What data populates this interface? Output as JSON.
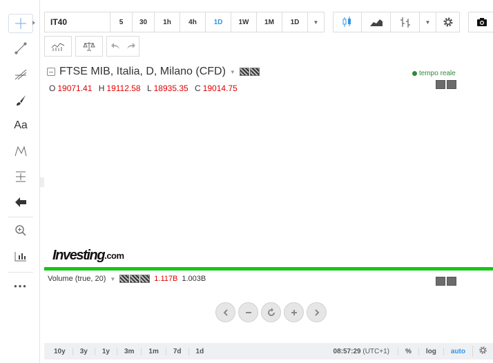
{
  "toolbar": {
    "symbol": "IT40",
    "intervals": [
      "5",
      "30",
      "1h",
      "4h",
      "1D",
      "1W",
      "1M"
    ],
    "active_interval": "1D",
    "resolution_label": "1D",
    "dropdown_glyph": "▼"
  },
  "chart": {
    "title": "FTSE MIB, Italia, D, Milano (CFD)",
    "ohlc": {
      "o_label": "O",
      "o": "19071.41",
      "h_label": "H",
      "h": "19112.58",
      "l_label": "L",
      "l": "18935.35",
      "c_label": "C",
      "c": "19014.75"
    },
    "realtime_label": "tempo reale",
    "logo_word": "Investing",
    "logo_suffix": ".com"
  },
  "volume": {
    "label": "Volume (true, 20)",
    "value_1": "1.117B",
    "value_2": "1.003B"
  },
  "bottom": {
    "ranges": [
      "10y",
      "3y",
      "1y",
      "3m",
      "1m",
      "7d",
      "1d"
    ],
    "time": "08:57:29",
    "timezone": "(UTC+1)",
    "percent": "%",
    "log": "log",
    "auto": "auto"
  },
  "left_tools": {
    "text_tool": "Aa",
    "more": "•••"
  },
  "colors": {
    "accent": "#2f96e6",
    "price_red": "#e00000",
    "divider_green": "#17c616",
    "realtime_green": "#2c8a3a"
  }
}
